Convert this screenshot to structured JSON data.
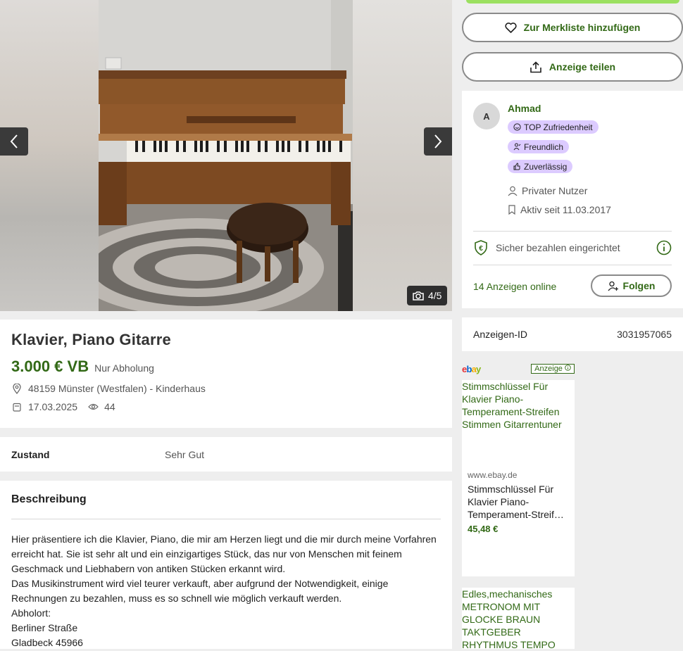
{
  "gallery": {
    "counter": "4/5",
    "prev_icon": "chevron-left-icon",
    "next_icon": "chevron-right-icon",
    "camera_icon": "camera-icon"
  },
  "listing": {
    "title": "Klavier, Piano Gitarre",
    "price": "3.000 € VB",
    "price_note": "Nur Abholung",
    "location": "48159 Münster (Westfalen) - Kinderhaus",
    "date": "17.03.2025",
    "views": "44"
  },
  "details": {
    "zustand_label": "Zustand",
    "zustand_value": "Sehr Gut"
  },
  "description": {
    "heading": "Beschreibung",
    "lines": [
      "Hier präsentiere ich die Klavier, Piano, die mir am Herzen liegt und die mir durch meine Vorfahren",
      "erreicht hat. Sie ist sehr alt und ein einzigartiges Stück, das nur von Menschen mit feinem",
      "Geschmack und Liebhabern von antiken Stücken erkannt wird.",
      "Das Musikinstrument wird viel teurer verkauft, aber aufgrund der Notwendigkeit, einige",
      "Rechnungen zu bezahlen, muss es so schnell wie möglich verkauft werden.",
      "Abholort:",
      "Berliner Straße",
      "Gladbeck 45966"
    ]
  },
  "actions": {
    "merkliste_label": "Zur Merkliste hinzufügen",
    "teilen_label": "Anzeige teilen"
  },
  "seller": {
    "avatar_initial": "A",
    "name": "Ahmad",
    "badges": [
      "TOP Zufriedenheit",
      "Freundlich",
      "Zuverlässig"
    ],
    "type": "Privater Nutzer",
    "active_since": "Aktiv seit 11.03.2017",
    "secure_payment": "Sicher bezahlen eingerichtet",
    "ads_online": "14 Anzeigen online",
    "follow_label": "Folgen"
  },
  "ad_id": {
    "label": "Anzeigen-ID",
    "value": "3031957065"
  },
  "ads": {
    "tag": "Anzeige",
    "logo_letters": [
      "e",
      "b",
      "a",
      "y"
    ],
    "ad1": {
      "headline_lines": [
        "Stimmschlüssel Für",
        "Klavier Piano-",
        "Temperament-Streifen",
        "Stimmen Gitarrentuner"
      ],
      "url": "www.ebay.de",
      "product_lines": [
        "Stimmschlüssel Für",
        "Klavier Piano-",
        "Temperament-Streif…"
      ],
      "price": "45,48 €"
    },
    "ad2": {
      "headline_lines": [
        "Edles,mechanisches",
        "METRONOM MIT",
        "GLOCKE BRAUN",
        "TAKTGEBER",
        "RHYTHMUS TEMPO"
      ]
    }
  },
  "colors": {
    "accent_green": "#326916",
    "badge_purple": "#dccbff",
    "cta_lime": "#9be060"
  }
}
